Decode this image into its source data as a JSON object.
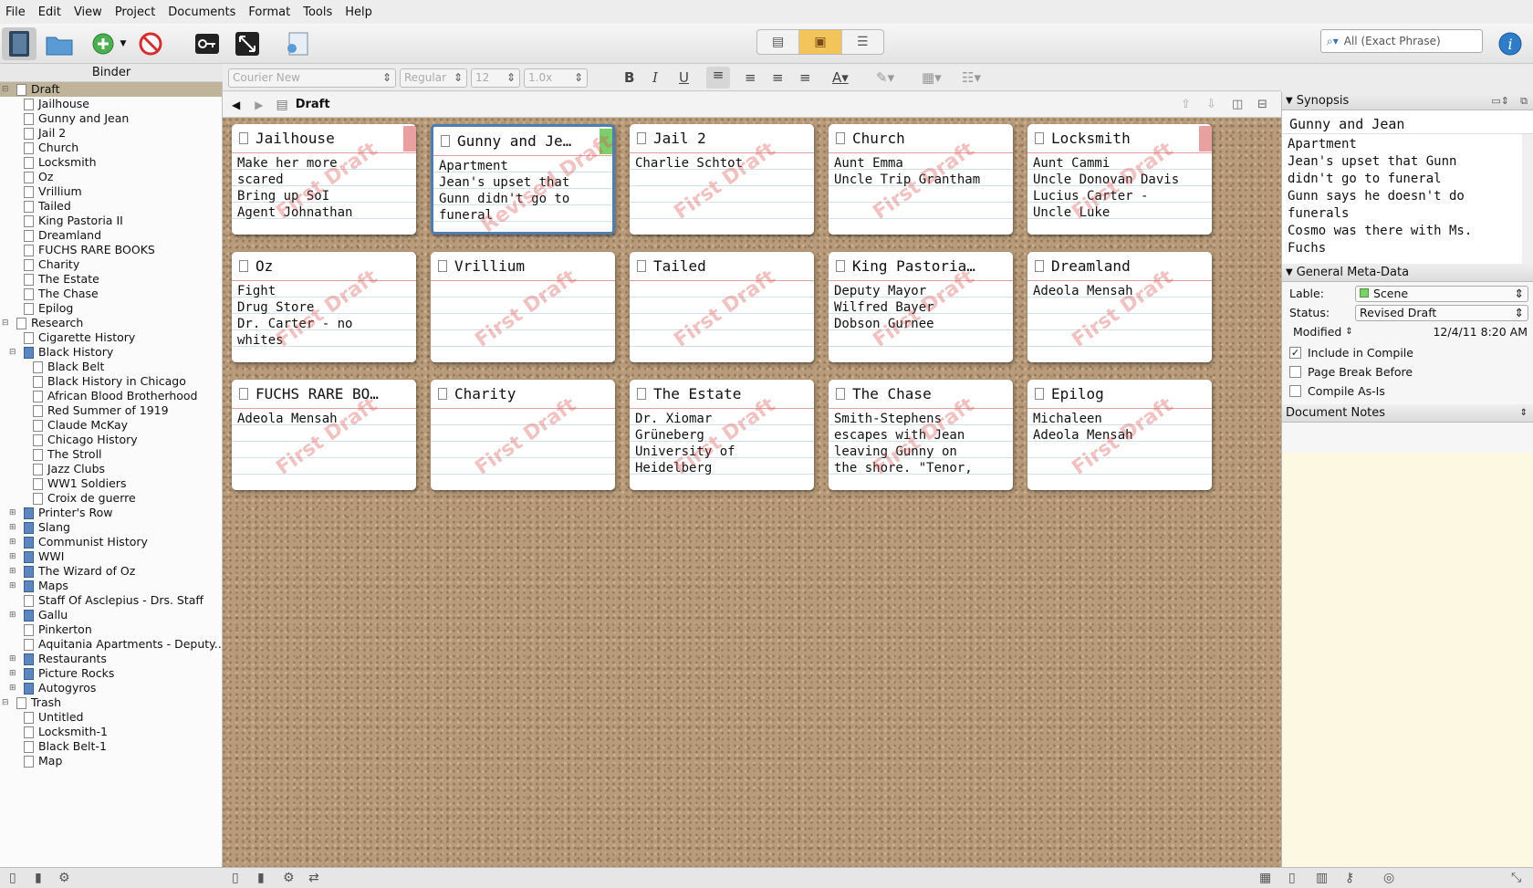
{
  "menu": [
    "File",
    "Edit",
    "View",
    "Project",
    "Documents",
    "Format",
    "Tools",
    "Help"
  ],
  "search": {
    "placeholder": "All (Exact Phrase)"
  },
  "binder": {
    "title": "Binder",
    "items": [
      {
        "label": "Draft",
        "level": 0,
        "type": "draft",
        "toggle": "−",
        "selected": true
      },
      {
        "label": "Jailhouse",
        "level": 1,
        "type": "doc"
      },
      {
        "label": "Gunny and Jean",
        "level": 1,
        "type": "doc"
      },
      {
        "label": "Jail 2",
        "level": 1,
        "type": "doc"
      },
      {
        "label": "Church",
        "level": 1,
        "type": "doc"
      },
      {
        "label": "Locksmith",
        "level": 1,
        "type": "doc"
      },
      {
        "label": "Oz",
        "level": 1,
        "type": "doc"
      },
      {
        "label": "Vrillium",
        "level": 1,
        "type": "doc"
      },
      {
        "label": "Tailed",
        "level": 1,
        "type": "doc"
      },
      {
        "label": "King Pastoria II",
        "level": 1,
        "type": "doc"
      },
      {
        "label": "Dreamland",
        "level": 1,
        "type": "doc"
      },
      {
        "label": "FUCHS RARE BOOKS",
        "level": 1,
        "type": "doc"
      },
      {
        "label": "Charity",
        "level": 1,
        "type": "doc"
      },
      {
        "label": "The Estate",
        "level": 1,
        "type": "doc"
      },
      {
        "label": "The Chase",
        "level": 1,
        "type": "doc"
      },
      {
        "label": "Epilog",
        "level": 1,
        "type": "doc"
      },
      {
        "label": "Research",
        "level": 0,
        "type": "research",
        "toggle": "−"
      },
      {
        "label": "Cigarette History",
        "level": 1,
        "type": "doc"
      },
      {
        "label": "Black History",
        "level": 1,
        "type": "folder",
        "toggle": "−"
      },
      {
        "label": "Black Belt",
        "level": 2,
        "type": "doc"
      },
      {
        "label": "Black History in Chicago",
        "level": 2,
        "type": "doc"
      },
      {
        "label": "African Blood Brotherhood",
        "level": 2,
        "type": "doc"
      },
      {
        "label": "Red Summer of 1919",
        "level": 2,
        "type": "doc"
      },
      {
        "label": "Claude McKay",
        "level": 2,
        "type": "doc"
      },
      {
        "label": "Chicago History",
        "level": 2,
        "type": "doc"
      },
      {
        "label": "The Stroll",
        "level": 2,
        "type": "doc"
      },
      {
        "label": "Jazz Clubs",
        "level": 2,
        "type": "doc"
      },
      {
        "label": "WW1 Soldiers",
        "level": 2,
        "type": "doc"
      },
      {
        "label": "Croix de guerre",
        "level": 2,
        "type": "doc"
      },
      {
        "label": "Printer's Row",
        "level": 1,
        "type": "folder",
        "toggle": "+"
      },
      {
        "label": "Slang",
        "level": 1,
        "type": "folder",
        "toggle": "+"
      },
      {
        "label": "Communist History",
        "level": 1,
        "type": "folder",
        "toggle": "+"
      },
      {
        "label": "WWI",
        "level": 1,
        "type": "folder",
        "toggle": "+"
      },
      {
        "label": "The Wizard of Oz",
        "level": 1,
        "type": "folder",
        "toggle": "+"
      },
      {
        "label": "Maps",
        "level": 1,
        "type": "folder",
        "toggle": "+"
      },
      {
        "label": "Staff Of Asclepius - Drs. Staff",
        "level": 1,
        "type": "doc"
      },
      {
        "label": "Gallu",
        "level": 1,
        "type": "folder",
        "toggle": "+"
      },
      {
        "label": "Pinkerton",
        "level": 1,
        "type": "doc"
      },
      {
        "label": "Aquitania Apartments - Deputy...",
        "level": 1,
        "type": "doc"
      },
      {
        "label": "Restaurants",
        "level": 1,
        "type": "folder",
        "toggle": "+"
      },
      {
        "label": "Picture Rocks",
        "level": 1,
        "type": "folder",
        "toggle": "+"
      },
      {
        "label": "Autogyros",
        "level": 1,
        "type": "folder",
        "toggle": "+"
      },
      {
        "label": "Trash",
        "level": 0,
        "type": "trash",
        "toggle": "−"
      },
      {
        "label": "Untitled",
        "level": 1,
        "type": "doc"
      },
      {
        "label": "Locksmith-1",
        "level": 1,
        "type": "doc"
      },
      {
        "label": "Black Belt-1",
        "level": 1,
        "type": "doc"
      },
      {
        "label": "Map",
        "level": 1,
        "type": "doc"
      }
    ]
  },
  "format": {
    "font": "Courier New",
    "style": "Regular",
    "size": "12",
    "spacing": "1.0x"
  },
  "editor": {
    "title": "Draft"
  },
  "cards": [
    {
      "title": "Jailhouse",
      "body": "Make her more\nscared\nBring up SoI\nAgent Johnathan",
      "label_color": "#e8a0a0",
      "stamp": "First Draft"
    },
    {
      "title": "Gunny and Je…",
      "body": "Apartment\nJean's upset that\nGunn didn't go to\nfuneral",
      "label_color": "#7ccf6a",
      "stamp": "Revised Draft",
      "selected": true
    },
    {
      "title": "Jail 2",
      "body": "Charlie Schtot",
      "stamp": "First Draft"
    },
    {
      "title": "Church",
      "body": "Aunt Emma\nUncle Trip Grantham",
      "stamp": "First Draft"
    },
    {
      "title": "Locksmith",
      "body": "Aunt Cammi\nUncle Donovan Davis\nLucius Carter -\nUncle Luke",
      "label_color": "#e8a0a0",
      "stamp": "First Draft"
    },
    {
      "title": "Oz",
      "body": "Fight\nDrug Store\nDr. Carter - no\nwhites",
      "stamp": "First Draft"
    },
    {
      "title": "Vrillium",
      "body": "",
      "stamp": "First Draft"
    },
    {
      "title": "Tailed",
      "body": "",
      "stamp": "First Draft"
    },
    {
      "title": "King Pastoria…",
      "body": "Deputy Mayor\nWilfred Bayer\nDobson Gurnee",
      "stamp": "First Draft"
    },
    {
      "title": "Dreamland",
      "body": "Adeola Mensah",
      "stamp": "First Draft"
    },
    {
      "title": "FUCHS RARE BO…",
      "body": "Adeola Mensah",
      "stamp": "First Draft"
    },
    {
      "title": "Charity",
      "body": "",
      "stamp": "First Draft"
    },
    {
      "title": "The Estate",
      "body": "Dr. Xiomar\nGrüneberg\nUniversity of\nHeidelberg",
      "stamp": "First Draft"
    },
    {
      "title": "The Chase",
      "body": "Smith-Stephens\nescapes with Jean\nleaving Gunny on\nthe shore. \"Tenor,",
      "stamp": "First Draft"
    },
    {
      "title": "Epilog",
      "body": "Michaleen\nAdeola Mensah",
      "stamp": "First Draft"
    }
  ],
  "inspector": {
    "synopsis_header": "Synopsis",
    "synopsis_title": "Gunny and Jean",
    "synopsis_text": "Apartment\nJean's upset that Gunn\ndidn't go to funeral\nGunn says he doesn't do\nfunerals\nCosmo was there with Ms.\nFuchs",
    "meta_header": "General Meta-Data",
    "label_label": "Lable:",
    "label_value": "Scene",
    "label_color": "#7ccf6a",
    "status_label": "Status:",
    "status_value": "Revised Draft",
    "modified_label": "Modified",
    "modified_value": "12/4/11 8:20 AM",
    "include_compile": "Include in Compile",
    "include_checked": "✓",
    "page_break": "Page Break Before",
    "compile_as_is": "Compile As-Is",
    "notes_header": "Document Notes"
  }
}
